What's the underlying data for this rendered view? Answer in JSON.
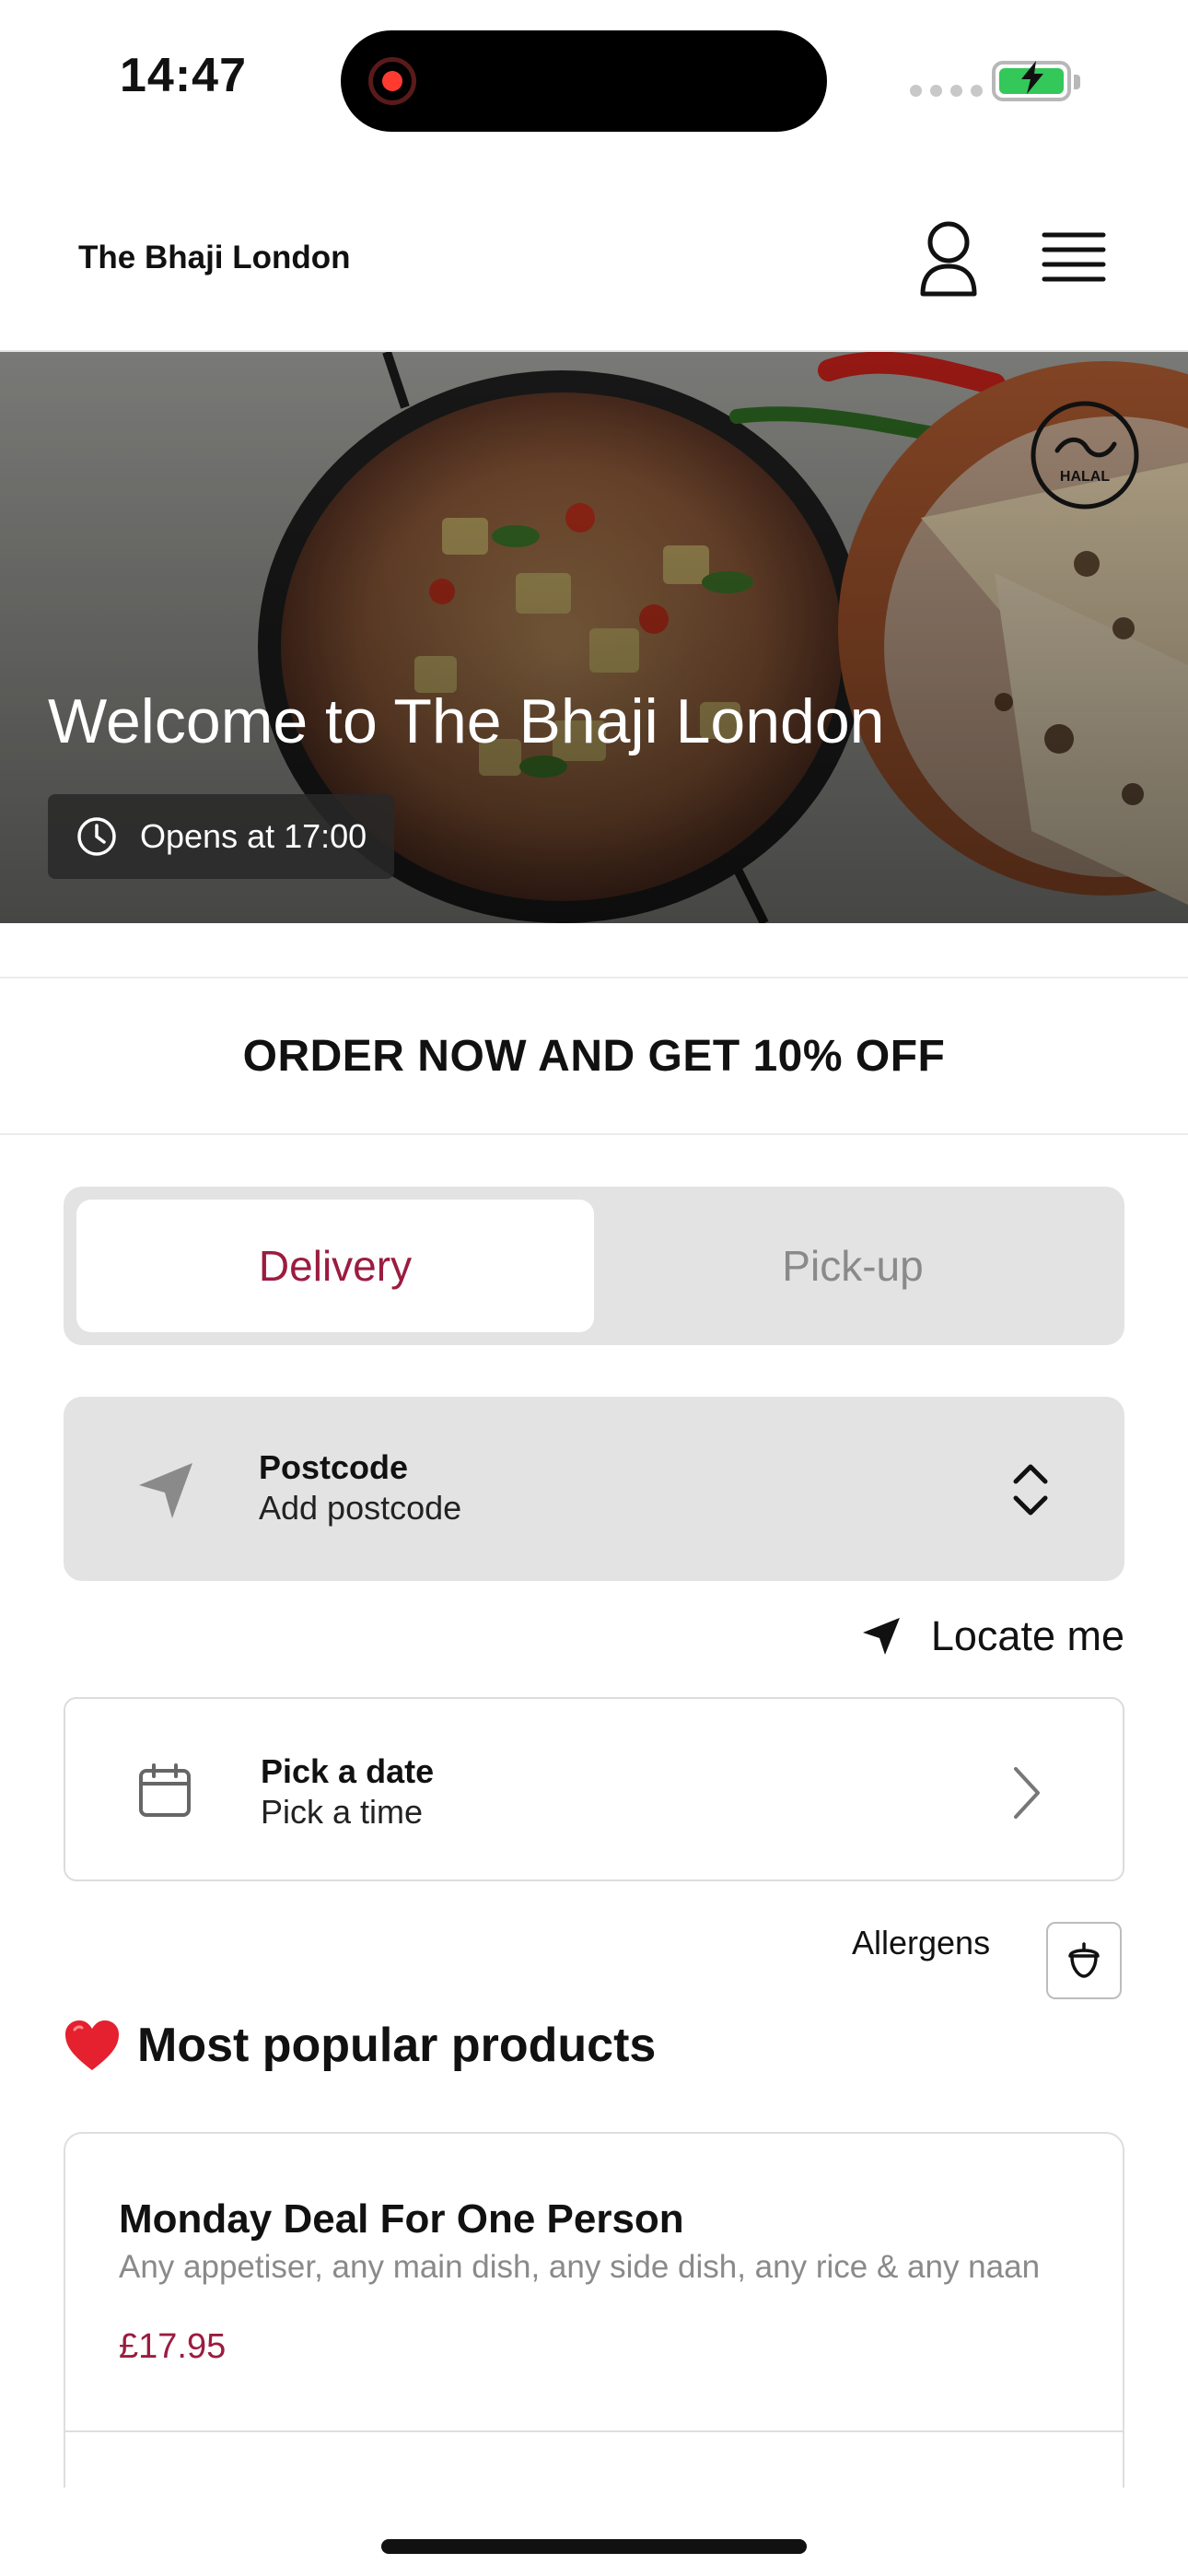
{
  "status_bar": {
    "time": "14:47"
  },
  "header": {
    "brand": "The Bhaji London",
    "icons": [
      "account-icon",
      "menu-icon"
    ]
  },
  "hero": {
    "title": "Welcome to The Bhaji London",
    "hours": "Opens at 17:00",
    "badge_icon": "clock-icon",
    "halal_mark": "HALAL"
  },
  "promo": {
    "text": "ORDER NOW AND GET 10% OFF"
  },
  "fulfillment": {
    "options": [
      "Delivery",
      "Pick-up"
    ],
    "selected": "Delivery"
  },
  "postcode": {
    "label": "Postcode",
    "value": "Add postcode"
  },
  "locate": {
    "label": "Locate me"
  },
  "schedule": {
    "date_label": "Pick a date",
    "time_label": "Pick a time"
  },
  "allergens": {
    "label": "Allergens"
  },
  "popular": {
    "title": "Most popular products",
    "products": [
      {
        "name": "Monday Deal For One Person",
        "description": "Any appetiser, any main dish, any side dish, any rice & any naan",
        "price": "£17.95"
      }
    ]
  },
  "colors": {
    "accent": "#9b1c3f",
    "segment_bg": "#e3e3e3",
    "battery": "#34c759"
  }
}
